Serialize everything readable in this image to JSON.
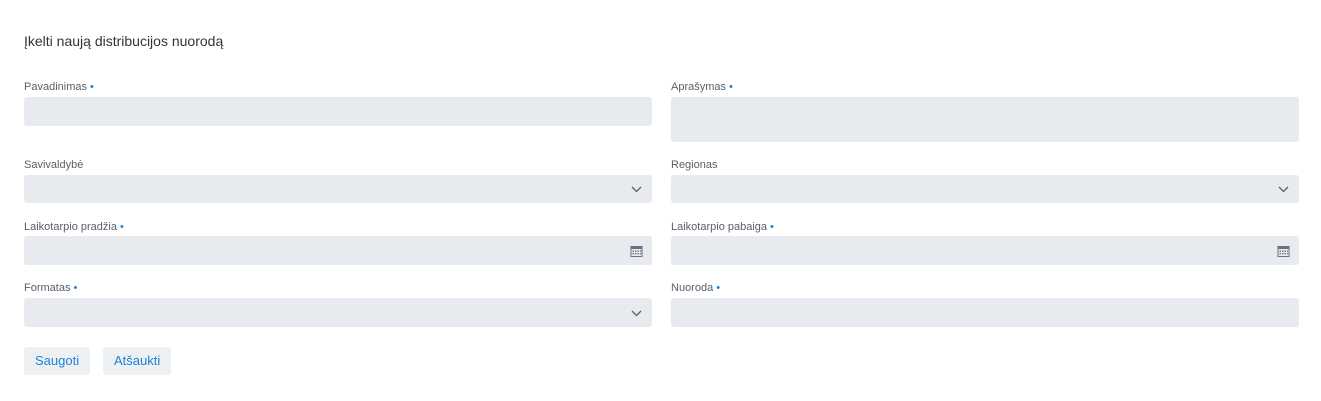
{
  "form": {
    "title": "Įkelti naują distribucijos nuorodą",
    "required_marker": "•",
    "fields": {
      "name": {
        "label": "Pavadinimas",
        "value": "",
        "required": true
      },
      "description": {
        "label": "Aprašymas",
        "value": "",
        "required": true
      },
      "municipality": {
        "label": "Savivaldybė",
        "value": "",
        "required": false
      },
      "region": {
        "label": "Regionas",
        "value": "",
        "required": false
      },
      "period_start": {
        "label": "Laikotarpio pradžia",
        "value": "",
        "required": true
      },
      "period_end": {
        "label": "Laikotarpio pabaiga",
        "value": "",
        "required": true
      },
      "format": {
        "label": "Formatas",
        "value": "",
        "required": true
      },
      "link": {
        "label": "Nuoroda",
        "value": "",
        "required": true
      }
    },
    "actions": {
      "save_label": "Saugoti",
      "cancel_label": "Atšaukti"
    }
  },
  "icons": {
    "dropdown": "chevron-down-icon",
    "date": "calendar-icon"
  },
  "colors": {
    "accent": "#1f7fd6",
    "input_background": "#e7eaee",
    "label_text": "#5a5f66",
    "title_text": "#2f3338"
  }
}
